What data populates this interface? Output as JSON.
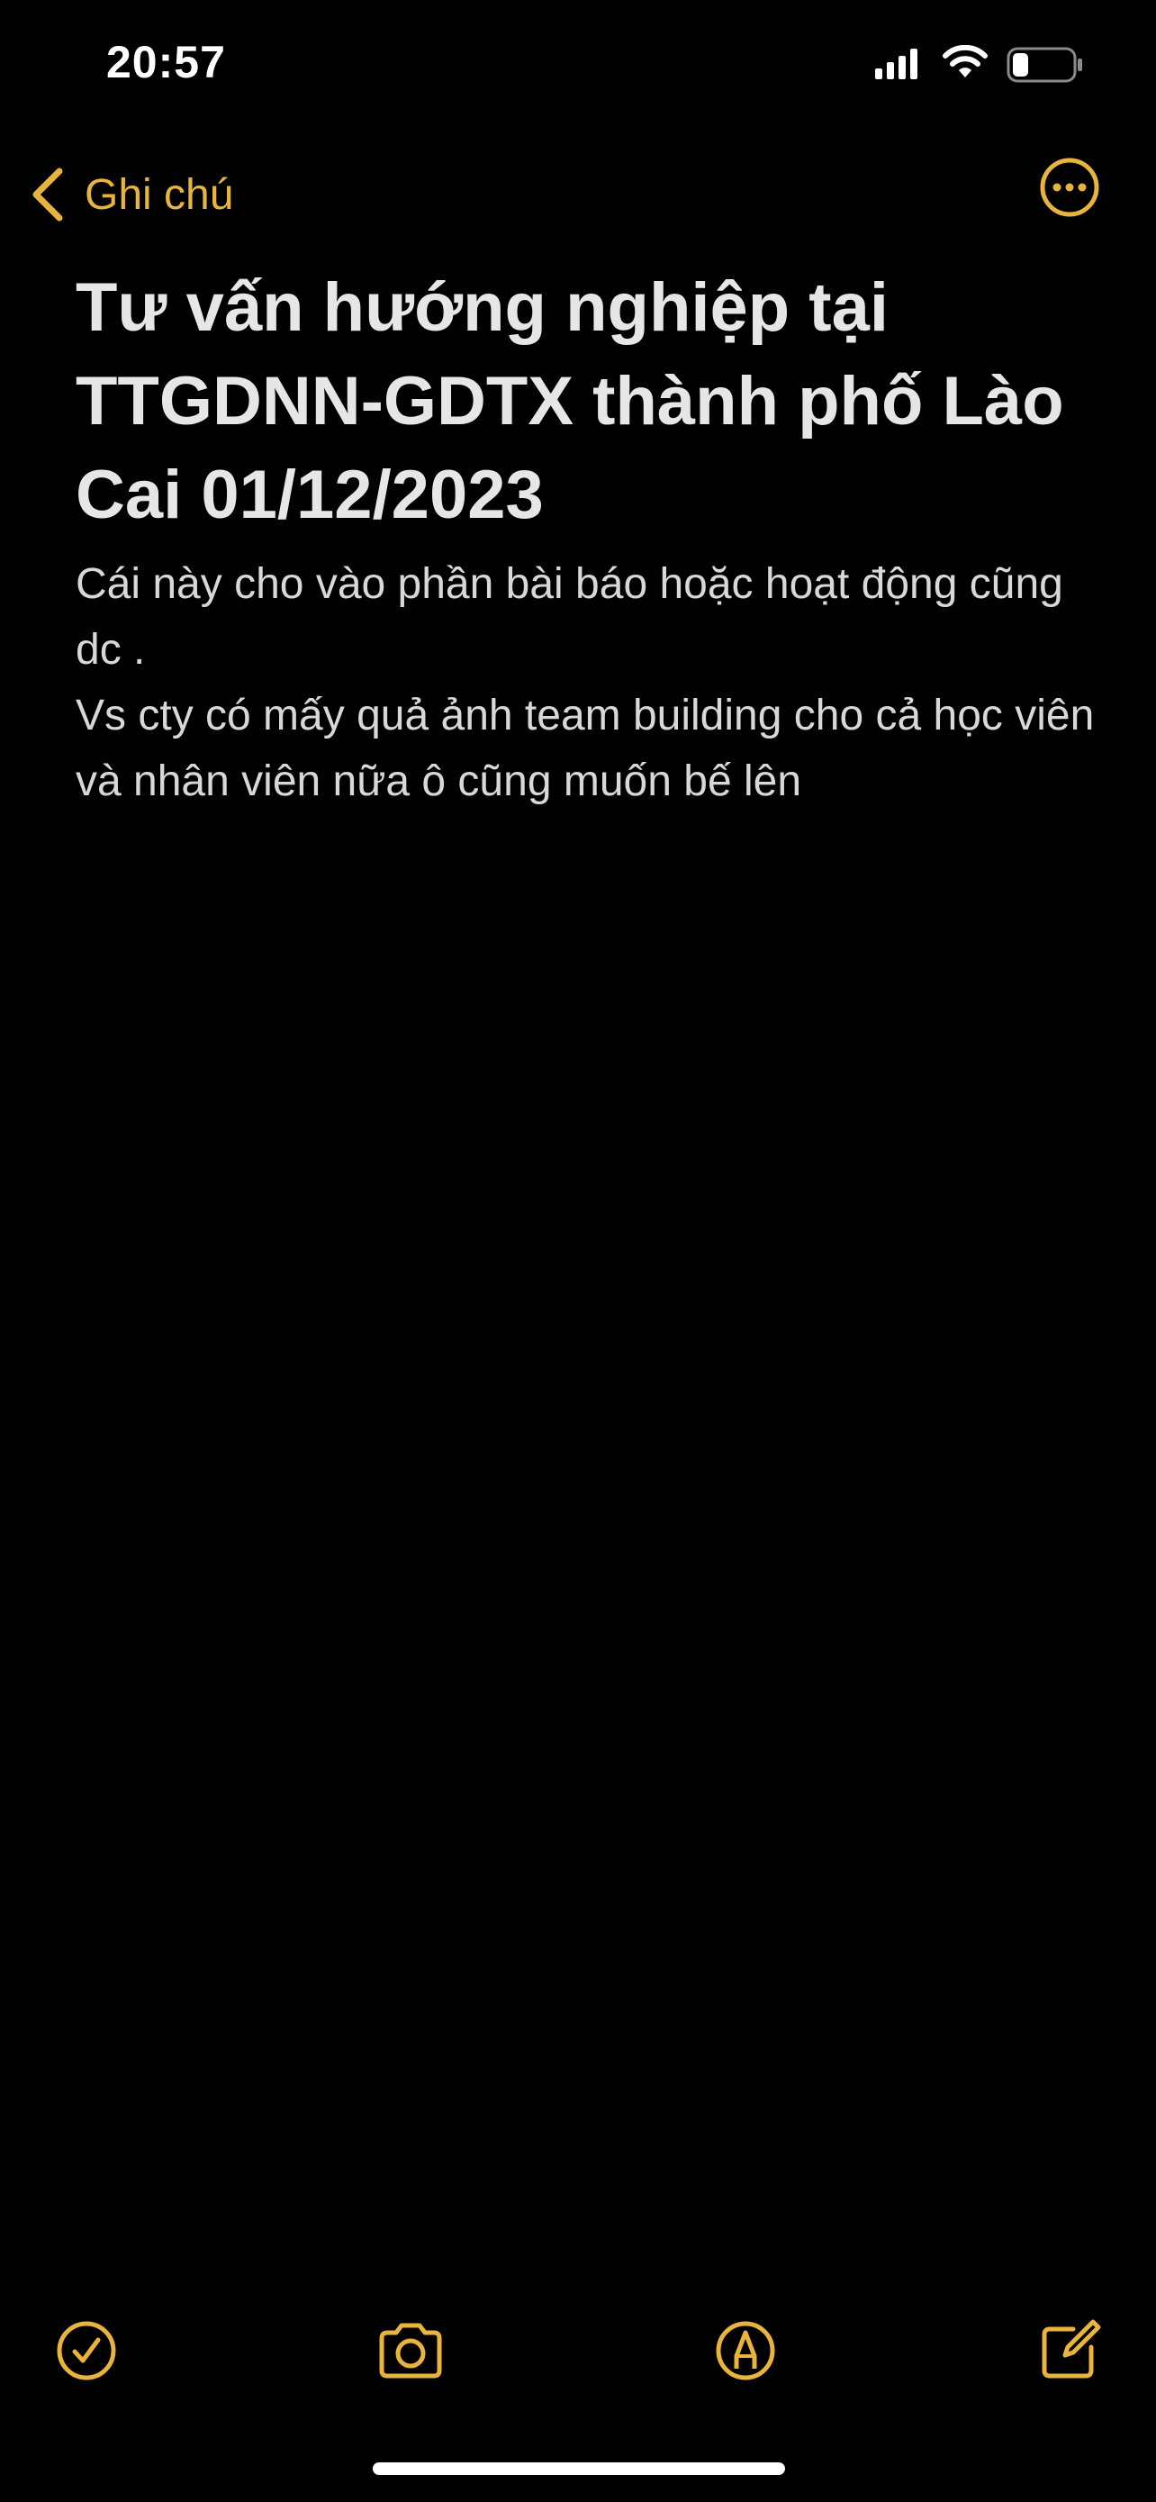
{
  "status_bar": {
    "time": "20:57",
    "icons": [
      "signal-icon",
      "wifi-icon",
      "battery-icon"
    ],
    "battery_level": 0.25
  },
  "nav": {
    "back_label": "Ghi chú",
    "back_icon": "chevron-left-icon",
    "more_icon": "ellipsis-circle-icon"
  },
  "note": {
    "title": "Tư vấn hướng nghiệp tại TTGDNN-GDTX thành phố Lào Cai 01/12/2023",
    "body": [
      "Cái này cho vào phần bài báo hoặc hoạt động cũng dc .",
      "Vs cty có mấy quả ảnh team building cho cả học viên và nhân viên nữa ô cũng muốn bế lên"
    ]
  },
  "toolbar": {
    "icons": [
      "checklist-icon",
      "camera-icon",
      "markup-icon",
      "compose-icon"
    ]
  },
  "colors": {
    "background": "#000000",
    "accent": "#e8b43c",
    "title_text": "#e6e6e6",
    "body_text": "#d8d8d8"
  }
}
